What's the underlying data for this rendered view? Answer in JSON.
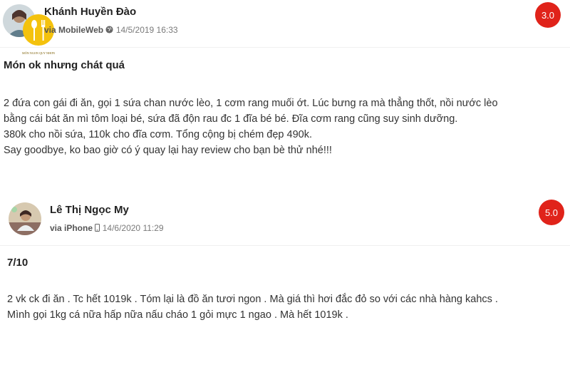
{
  "reviews": [
    {
      "author": "Khánh Huyền Đào",
      "via": "via MobileWeb",
      "platform_icon": "globe-icon",
      "date": "14/5/2019 16:33",
      "score": "3.0",
      "title": "Món ok nhưng chát quá",
      "body": [
        "2 đứa con gái đi ăn, gọi 1 sứa chan nước lèo, 1 cơm rang muối ớt. Lúc bưng ra mà thẳng thốt, nồi nước lèo",
        "bằng cái bát ăn mì tôm loại bé, sứa đã độn rau đc 1 đĩa bé bé. Đĩa cơm rang cũng suy sinh dưỡng.",
        "380k cho nồi sứa, 110k cho đĩa cơm. Tổng cộng bị chém đẹp 490k.",
        "Say goodbye, ko bao giờ có ý quay lại hay review cho bạn bè thử nhé!!!"
      ]
    },
    {
      "author": "Lê Thị Ngọc My",
      "via": "via iPhone",
      "platform_icon": "phone-icon",
      "date": "14/6/2020 11:29",
      "score": "5.0",
      "title": "7/10",
      "body": [
        "2 vk ck đi ăn . Tc hết 1019k . Tóm lại là đồ ăn tươi ngon . Mà giá thì hơi đắc đỏ so với các nhà hàng kahcs .",
        "Mình gọi 1kg cá nữa hấp nữa nấu cháo 1 gỏi mực 1 ngao . Mà hết 1019k ."
      ]
    }
  ],
  "watermark": {
    "icon": "restaurant-logo-icon",
    "text": "MÓN NGON QUY NHƠN"
  },
  "colors": {
    "score_badge": "#e0231a",
    "logo_yellow": "#f4c20d"
  }
}
